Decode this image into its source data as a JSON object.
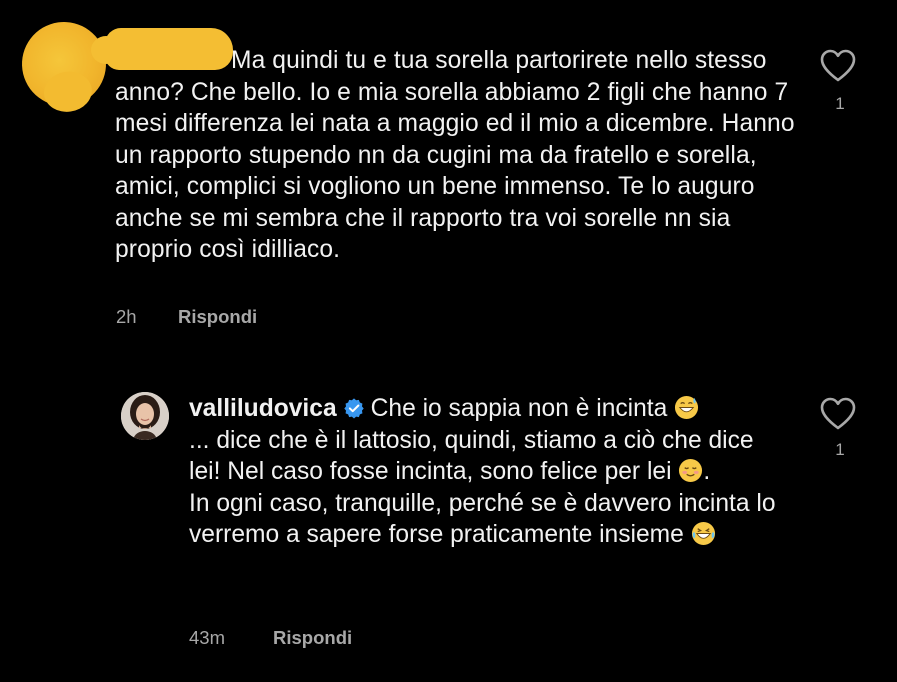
{
  "comments": [
    {
      "author_redacted": true,
      "text": "Ma quindi tu e tua sorella partorirete nello stesso anno? Che bello.  Io e mia sorella abbiamo 2 figli che hanno 7 mesi differenza lei nata a maggio ed il mio a dicembre.  Hanno un rapporto stupendo nn da cugini ma da fratello e sorella, amici, complici si vogliono un bene immenso.  Te lo auguro anche se mi sembra che il rapporto tra voi sorelle nn sia proprio così idilliaco.",
      "time": "2h",
      "reply_label": "Rispondi",
      "like_count": "1",
      "like_icon": "heart-outline-icon"
    },
    {
      "author": "valliludovica",
      "verified": true,
      "verified_icon": "verified-badge-icon",
      "line1": "Che io sappia non è incinta",
      "line2": "... dice che è il lattosio, quindi, stiamo a ciò che dice lei! Nel caso fosse incinta, sono felice per lei",
      "line2_end": ".",
      "line3": "In ogni caso, tranquille, perché se è davvero incinta lo verremo a sapere forse praticamente insieme",
      "emojis": [
        "grinning-sweat-emoji",
        "smiling-blush-emoji",
        "laughing-tears-emoji"
      ],
      "time": "43m",
      "reply_label": "Rispondi",
      "like_count": "1",
      "like_icon": "heart-outline-icon"
    }
  ],
  "colors": {
    "background": "#000000",
    "text": "#f2f2f2",
    "meta": "#a8a8a8",
    "verified": "#3897f0",
    "redaction": "#f4be33"
  }
}
